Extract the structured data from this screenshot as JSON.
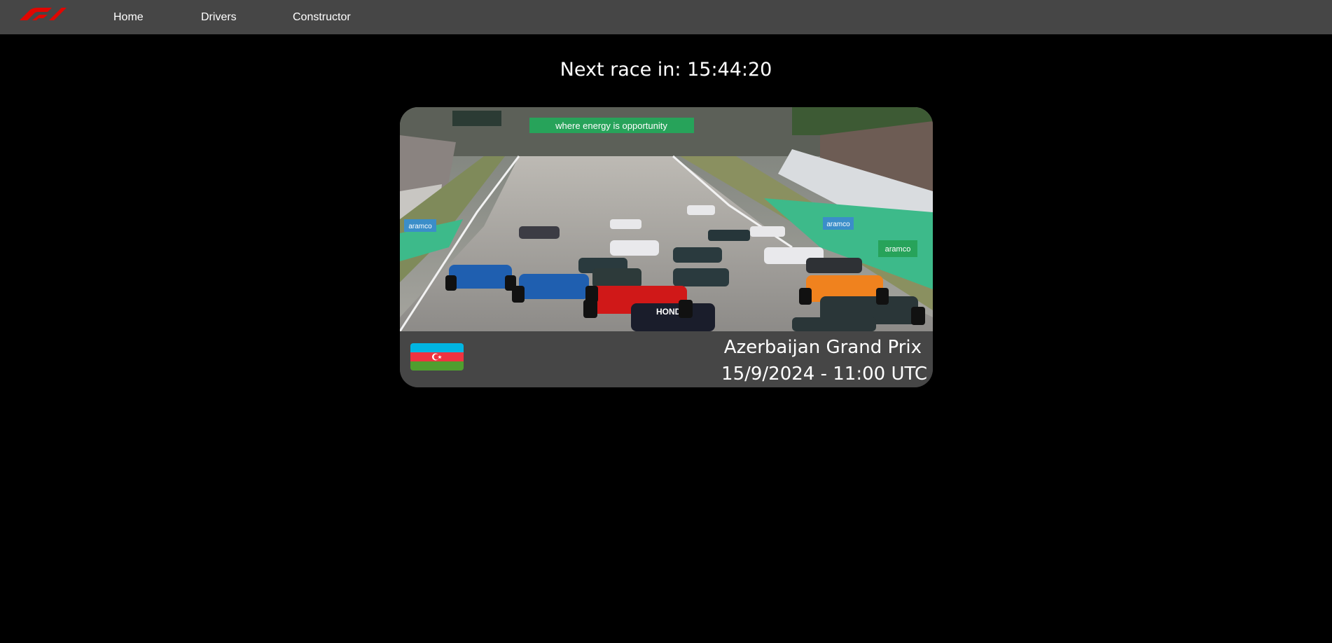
{
  "nav": {
    "logo": "F1",
    "items": [
      {
        "label": "Home"
      },
      {
        "label": "Drivers"
      },
      {
        "label": "Constructor"
      }
    ]
  },
  "countdown": {
    "text": "Next race in: 15:44:20"
  },
  "next_race": {
    "name": "Azerbaijan Grand Prix",
    "datetime": "15/9/2024 - 11:00 UTC",
    "flag_icon": "azerbaijan-flag-icon",
    "billboard_text": "where energy is opportunity",
    "sponsor_text": "aramco",
    "car_livery_text": "HONDA"
  },
  "colors": {
    "navbar_bg": "#464646",
    "page_bg": "#000000",
    "brand_red": "#e10600",
    "card_bg": "#464646",
    "text": "#ffffff"
  }
}
